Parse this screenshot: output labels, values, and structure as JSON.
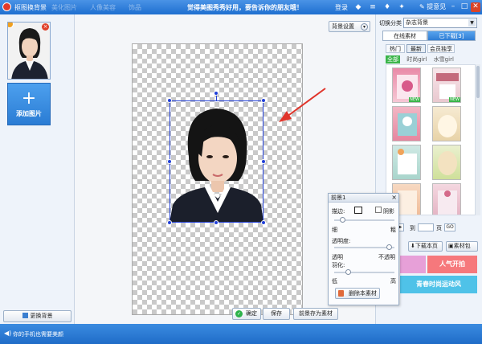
{
  "titlebar": {
    "app_title": "抠图换背景",
    "ghost_tabs": [
      "美化图片",
      "人像美容",
      "饰品",
      "文字"
    ],
    "slogan": "觉得美图秀秀好用，要告诉你的朋友哦！",
    "login": "登录",
    "feedback": "提意见"
  },
  "left_panel": {
    "add_image_label": "添加图片",
    "change_bg_label": "更换背景"
  },
  "canvas": {
    "bg_settings_label": "背景设置"
  },
  "bottom_buttons": {
    "confirm": "确定",
    "save": "保存",
    "save_as_material": "前景存为素材"
  },
  "foreground_panel": {
    "title": "前景1",
    "stroke_label": "描边:",
    "shadow_label": "阴影",
    "thin": "细",
    "thick": "粗",
    "opacity_label": "透明度:",
    "transparent": "透明",
    "opaque": "不透明",
    "feather_label": "羽化:",
    "low": "低",
    "high": "高",
    "delete_label": "删除本素材",
    "stroke_level": 0.1,
    "opacity_level": 0.95,
    "feather_level": 0.2
  },
  "right_panel": {
    "category_label": "切换分类",
    "category_value": "杂志背景",
    "tab_online": "在线素材",
    "tab_downloaded": "已下载[3]",
    "sub_tabs": [
      "热门",
      "最新",
      "会员独享"
    ],
    "filters": [
      "全部",
      "时尚girl",
      "水雪girl"
    ],
    "new_badge": "NEW",
    "pager_to": "到",
    "pager_page": "页",
    "pager_go": "GO",
    "download_page": "下载本页",
    "material_pack": "素材包",
    "ads": [
      "人气开拍",
      "青春时尚运动风"
    ]
  },
  "statusbar": {
    "text": "你的手机也需要美颜"
  }
}
